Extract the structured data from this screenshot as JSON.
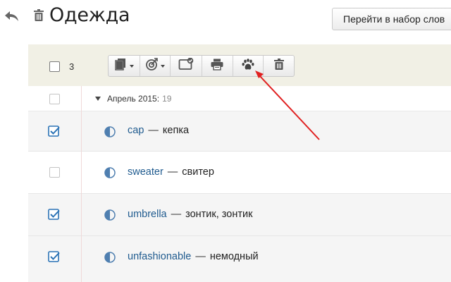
{
  "header": {
    "title": "Одежда",
    "goto_label": "Перейти в набор слов"
  },
  "toolbar": {
    "selected_count": "3"
  },
  "list": {
    "group": {
      "label": "Апрель 2015:",
      "count": "19"
    },
    "items": [
      {
        "word": "cap",
        "dash": "—",
        "translation": "кепка",
        "checked": true
      },
      {
        "word": "sweater",
        "dash": "—",
        "translation": "свитер",
        "checked": false
      },
      {
        "word": "umbrella",
        "dash": "—",
        "translation": "зонтик, зонтик",
        "checked": true
      },
      {
        "word": "unfashionable",
        "dash": "—",
        "translation": "немодный",
        "checked": true
      }
    ]
  },
  "colors": {
    "toolbar_bg": "#f1f0e5",
    "link_blue": "#1f5b8f",
    "checkbox_blue": "#2a72b5",
    "annotation_arrow": "#e02020"
  }
}
